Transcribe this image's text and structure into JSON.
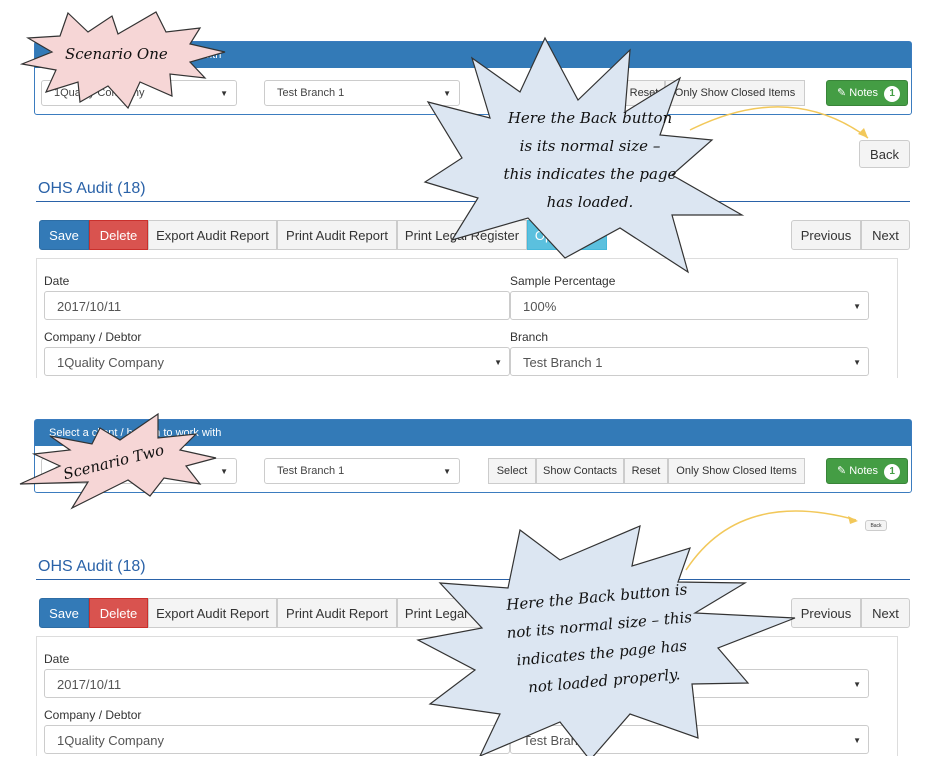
{
  "scenario_one": {
    "label": "Scenario One",
    "panel_heading": "Select a client / branch to work with",
    "company_select": "1Quality Company",
    "branch_select": "Test Branch 1",
    "toolbar": {
      "reset": "Reset",
      "only_show_closed": "Only Show Closed Items",
      "notes": "Notes",
      "notes_count": "1"
    },
    "back": "Back",
    "callout": [
      "Here the Back button",
      "is its normal size –",
      "this indicates the page",
      "has loaded."
    ]
  },
  "scenario_two": {
    "label": "Scenario Two",
    "panel_heading": "Select a client / branch to work with",
    "company_select": "1Quality Company",
    "branch_select": "Test Branch 1",
    "toolbar": {
      "select": "Select",
      "show_contacts": "Show Contacts",
      "reset": "Reset",
      "only_show_closed": "Only Show Closed Items",
      "notes": "Notes",
      "notes_count": "1"
    },
    "back": "Back",
    "callout": [
      "Here the Back button is",
      "not its normal size – this",
      "indicates the page has",
      "not loaded properly."
    ]
  },
  "audit": {
    "title": "OHS Audit (18)",
    "buttons": {
      "save": "Save",
      "delete": "Delete",
      "export": "Export Audit Report",
      "print": "Print Audit Report",
      "print_legal": "Print Legal Register",
      "open_audit": "Open Audit",
      "previous": "Previous",
      "next": "Next"
    },
    "form": {
      "date_label": "Date",
      "date_value": "2017/10/11",
      "sample_label": "Sample Percentage",
      "sample_value": "100%",
      "company_label": "Company / Debtor",
      "company_value": "1Quality Company",
      "branch_label": "Branch",
      "branch_value": "Test Branch 1"
    }
  },
  "colors": {
    "callout_fill": "#dce6f2",
    "scenario_fill": "#f6d6d6",
    "arrow": "#f2c85a",
    "primary": "#337ab7",
    "danger": "#d9534f",
    "success": "#449d44",
    "info": "#5bc0de"
  },
  "icons": {
    "caret": "caret-down-icon",
    "notes": "pencil-icon"
  }
}
